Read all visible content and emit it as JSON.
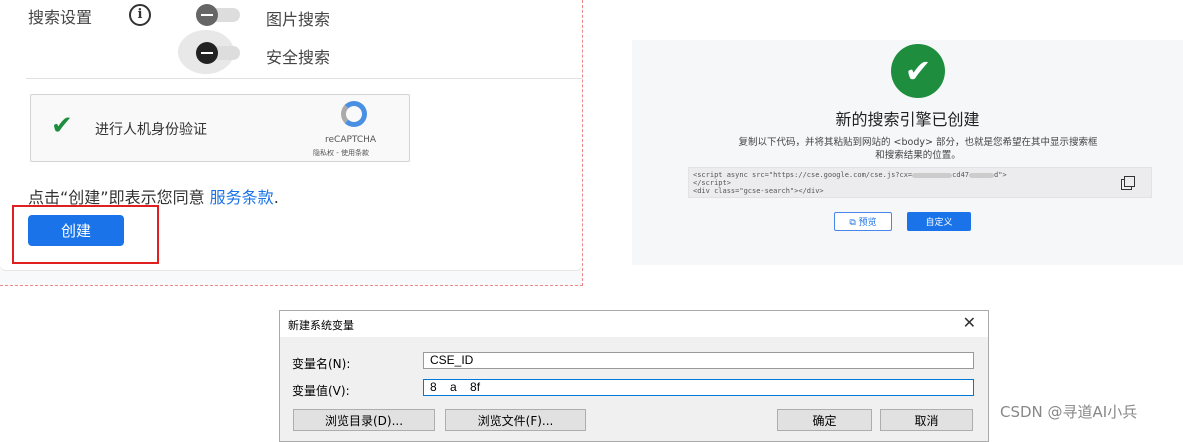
{
  "settings": {
    "title": "搜索设置",
    "image_search": "图片搜索",
    "safe_search": "安全搜索"
  },
  "captcha": {
    "label": "进行人机身份验证",
    "brand": "reCAPTCHA",
    "links": "隐私权 - 使用条款"
  },
  "terms": {
    "text": "点击“创建”即表示您同意 ",
    "link": "服务条款",
    "end": "."
  },
  "create_button": "创建",
  "success": {
    "title": "新的搜索引擎已创建",
    "desc1": "复制以下代码，并将其粘贴到网站的 <body> 部分，也就是您希望在其中显示搜索框",
    "desc2": "和搜索结果的位置。",
    "code1a": "<script async src=\"https://cse.google.com/cse.js?cx=",
    "code1b": "cd47",
    "code1c": "d\">",
    "code2": "</script>",
    "code3": "<div class=\"gcse-search\"></div>",
    "preview": "预览",
    "customize": "自定义"
  },
  "dialog": {
    "title": "新建系统变量",
    "name_label": "变量名(N):",
    "name_value": "CSE_ID",
    "value_label": "变量值(V):",
    "value_value": "8    a    8f",
    "browse_dir": "浏览目录(D)...",
    "browse_file": "浏览文件(F)...",
    "ok": "确定",
    "cancel": "取消"
  },
  "watermark": "CSDN @寻道AI小兵",
  "colors": {
    "accent": "#1a73e8",
    "success": "#1e8e3e",
    "highlight": "#e02020"
  }
}
